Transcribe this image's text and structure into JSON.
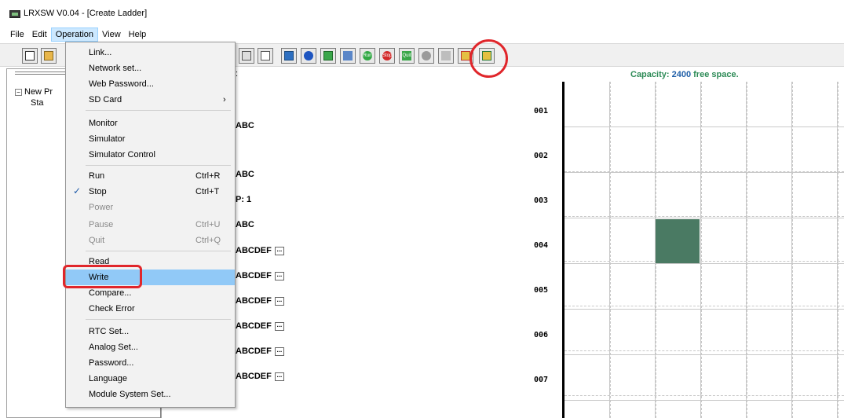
{
  "window": {
    "title": "LRXSW V0.04 - [Create Ladder]"
  },
  "menubar": {
    "items": [
      "File",
      "Edit",
      "Operation",
      "View",
      "Help"
    ]
  },
  "colors": {
    "accent_red": "#e0262b",
    "cell_fill": "#4a7a63",
    "capacity_text": "#2e8b57",
    "capacity_num": "#1f5fa8"
  },
  "toolbar": {
    "icons": [
      "new-icon",
      "open-icon",
      "save-icon",
      "cut-icon",
      "ladder-icon",
      "block-icon",
      "monitor-icon",
      "link-icon",
      "settings-icon",
      "tools-icon",
      "run-icon",
      "stop-icon",
      "quit-icon",
      "record-icon",
      "pause-icon",
      "read-icon",
      "write-icon"
    ],
    "labels": {
      "run": "Run",
      "stop": "Stop",
      "quit": "Quit"
    }
  },
  "tree": {
    "root": "New Pr",
    "child": "Sta"
  },
  "operation_menu": {
    "items": [
      {
        "label": "Link...",
        "shortcut": "",
        "disabled": false
      },
      {
        "label": "Network set...",
        "shortcut": "",
        "disabled": false
      },
      {
        "label": "Web Password...",
        "shortcut": "",
        "disabled": false
      },
      {
        "label": "SD Card",
        "shortcut": "",
        "submenu": true,
        "disabled": false
      },
      {
        "label": "Monitor",
        "shortcut": "",
        "disabled": false
      },
      {
        "label": "Simulator",
        "shortcut": "",
        "disabled": false
      },
      {
        "label": "Simulator Control",
        "shortcut": "",
        "disabled": false
      },
      {
        "label": "Run",
        "shortcut": "Ctrl+R",
        "disabled": false
      },
      {
        "label": "Stop",
        "shortcut": "Ctrl+T",
        "checked": true,
        "disabled": false
      },
      {
        "label": "Power",
        "shortcut": "",
        "disabled": true
      },
      {
        "label": "Pause",
        "shortcut": "Ctrl+U",
        "disabled": true
      },
      {
        "label": "Quit",
        "shortcut": "Ctrl+Q",
        "disabled": true
      },
      {
        "label": "Read",
        "shortcut": "",
        "disabled": false
      },
      {
        "label": "Write",
        "shortcut": "",
        "highlighted": true,
        "disabled": false
      },
      {
        "label": "Compare...",
        "shortcut": "",
        "disabled": false
      },
      {
        "label": "Check Error",
        "shortcut": "",
        "disabled": false
      },
      {
        "label": "RTC Set...",
        "shortcut": "",
        "disabled": false
      },
      {
        "label": "Analog Set...",
        "shortcut": "",
        "disabled": false
      },
      {
        "label": "Password...",
        "shortcut": "",
        "disabled": false
      },
      {
        "label": "Language",
        "shortcut": "",
        "disabled": false
      },
      {
        "label": "Module System Set...",
        "shortcut": "",
        "disabled": false
      }
    ]
  },
  "middle": {
    "colon": ":",
    "rows": [
      "ABC",
      "ABC",
      "P: 1",
      "ABC",
      "ABCDEF",
      "ABCDEF",
      "ABCDEF",
      "ABCDEF",
      "ABCDEF",
      "ABCDEF"
    ],
    "ellipsis": "..."
  },
  "ladder": {
    "capacity_label": "Capacity:",
    "capacity_value": "2400",
    "capacity_suffix": "free space.",
    "row_numbers": [
      "001",
      "002",
      "003",
      "004",
      "005",
      "006",
      "007"
    ]
  }
}
